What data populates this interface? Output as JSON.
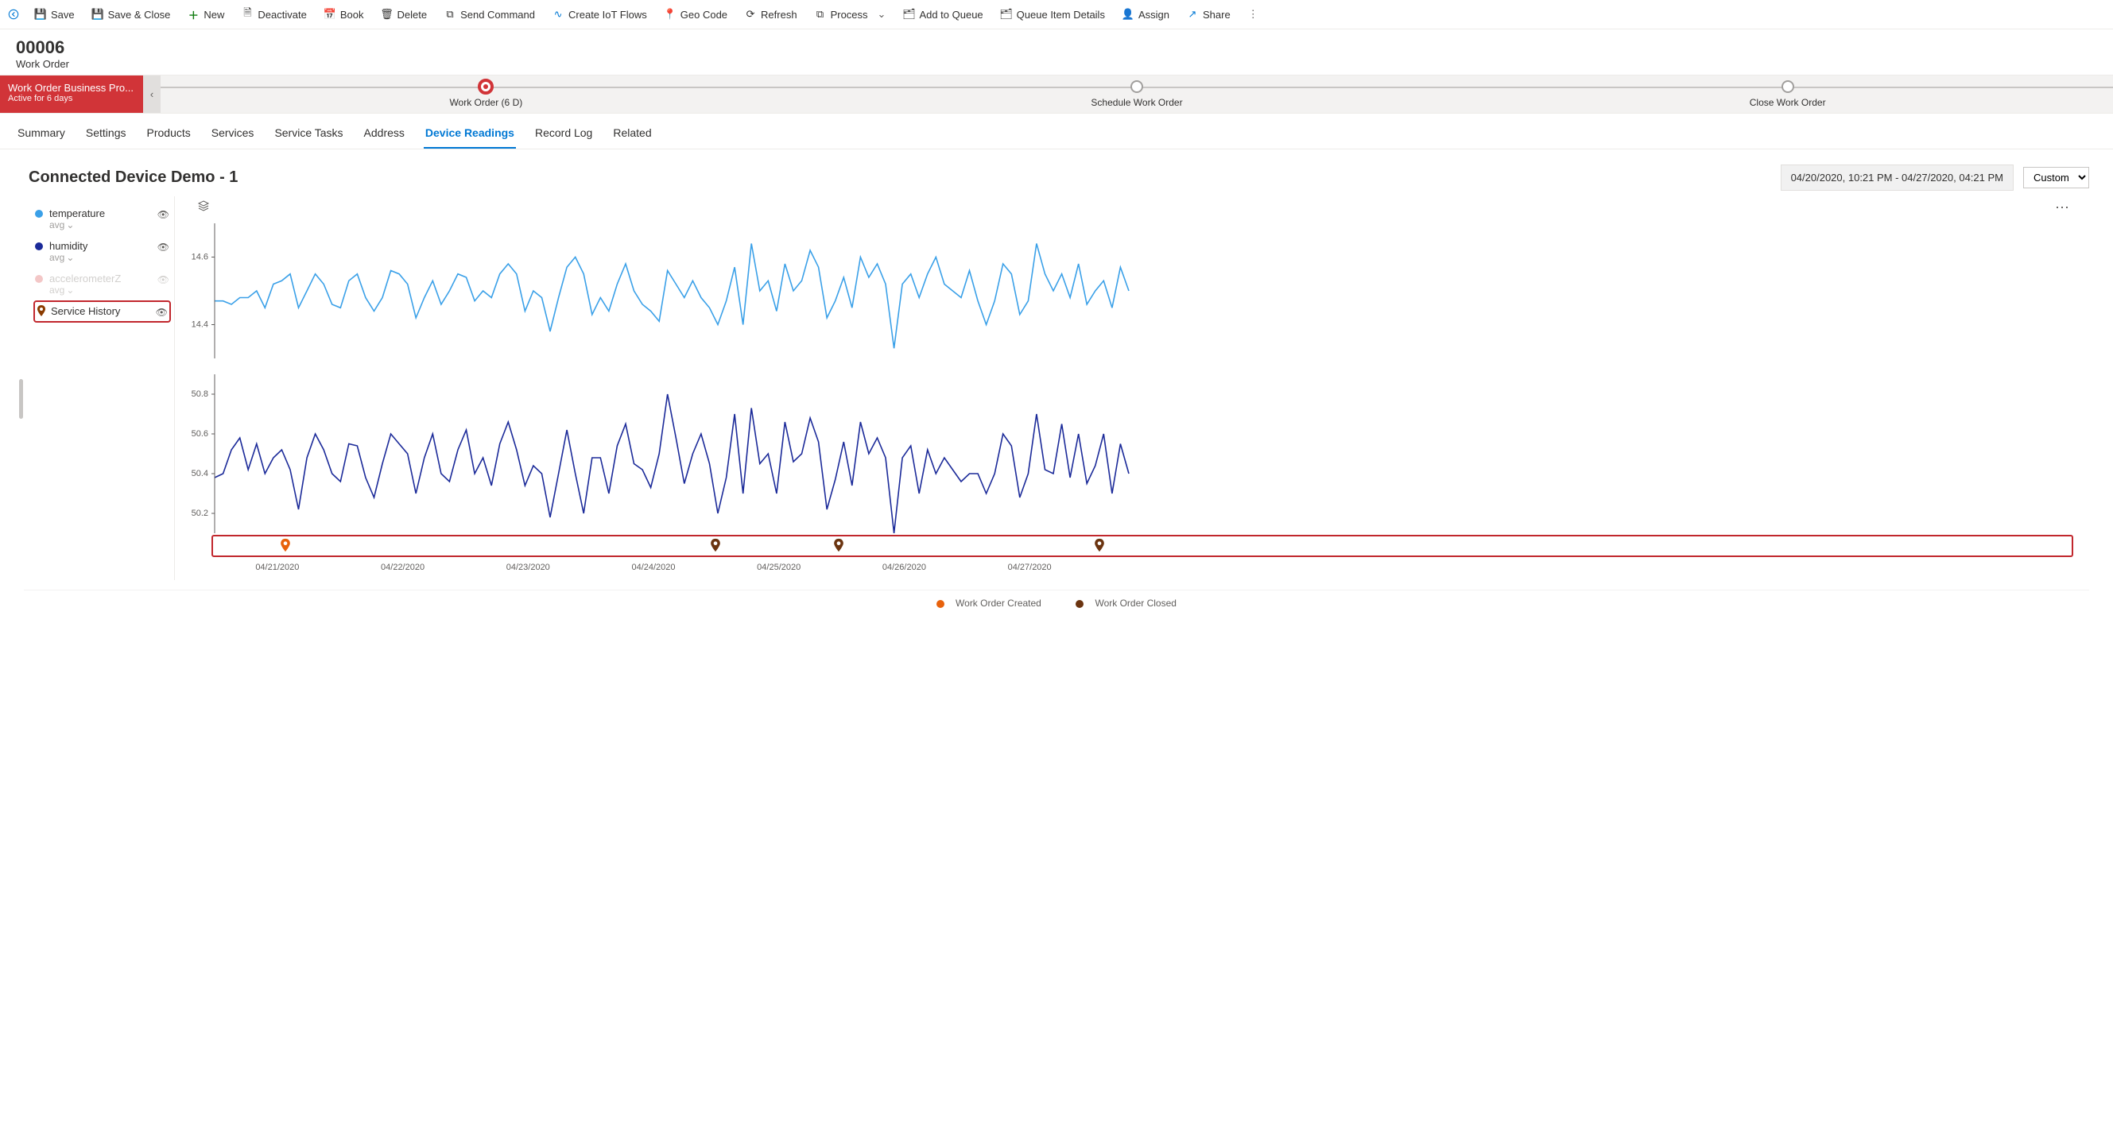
{
  "toolbar": {
    "save": "Save",
    "saveClose": "Save & Close",
    "new": "New",
    "deactivate": "Deactivate",
    "book": "Book",
    "delete": "Delete",
    "sendCommand": "Send Command",
    "createIot": "Create IoT Flows",
    "geoCode": "Geo Code",
    "refresh": "Refresh",
    "process": "Process",
    "addQueue": "Add to Queue",
    "queueDetails": "Queue Item Details",
    "assign": "Assign",
    "share": "Share"
  },
  "record": {
    "id": "00006",
    "type": "Work Order"
  },
  "process": {
    "name": "Work Order Business Pro...",
    "duration": "Active for 6 days",
    "stages": [
      {
        "label": "Work Order  (6 D)",
        "active": true
      },
      {
        "label": "Schedule Work Order",
        "active": false
      },
      {
        "label": "Close Work Order",
        "active": false
      }
    ]
  },
  "tabs": [
    "Summary",
    "Settings",
    "Products",
    "Services",
    "Service Tasks",
    "Address",
    "Device Readings",
    "Record Log",
    "Related"
  ],
  "activeTab": "Device Readings",
  "chart": {
    "title": "Connected Device Demo - 1",
    "range": "04/20/2020, 10:21 PM - 04/27/2020, 04:21 PM",
    "rangeMode": "Custom",
    "legend": [
      {
        "name": "temperature",
        "agg": "avg",
        "color": "#3aa0e8",
        "dim": false
      },
      {
        "name": "humidity",
        "agg": "avg",
        "color": "#1b2a99",
        "dim": false
      },
      {
        "name": "accelerometerZ",
        "agg": "avg",
        "color": "#f3c7c7",
        "dim": true
      }
    ],
    "serviceHistoryLabel": "Service History",
    "xTicks": [
      "04/21/2020",
      "04/22/2020",
      "04/23/2020",
      "04/24/2020",
      "04/25/2020",
      "04/26/2020",
      "04/27/2020"
    ],
    "bottomLegend": {
      "created": "Work Order Created",
      "closed": "Work Order Closed"
    }
  },
  "chart_data": [
    {
      "type": "line",
      "series_name": "temperature",
      "color": "#3aa0e8",
      "ylim": [
        14.3,
        14.7
      ],
      "yticks": [
        14.4,
        14.6
      ],
      "x_range": [
        "04/20/2020 22:21",
        "04/27/2020 16:21"
      ],
      "values": [
        14.47,
        14.47,
        14.46,
        14.48,
        14.48,
        14.5,
        14.45,
        14.52,
        14.53,
        14.55,
        14.45,
        14.5,
        14.55,
        14.52,
        14.46,
        14.45,
        14.53,
        14.55,
        14.48,
        14.44,
        14.48,
        14.56,
        14.55,
        14.52,
        14.42,
        14.48,
        14.53,
        14.46,
        14.5,
        14.55,
        14.54,
        14.47,
        14.5,
        14.48,
        14.55,
        14.58,
        14.55,
        14.44,
        14.5,
        14.48,
        14.38,
        14.48,
        14.57,
        14.6,
        14.55,
        14.43,
        14.48,
        14.44,
        14.52,
        14.58,
        14.5,
        14.46,
        14.44,
        14.41,
        14.56,
        14.52,
        14.48,
        14.53,
        14.48,
        14.45,
        14.4,
        14.47,
        14.57,
        14.4,
        14.64,
        14.5,
        14.53,
        14.44,
        14.58,
        14.5,
        14.53,
        14.62,
        14.57,
        14.42,
        14.47,
        14.54,
        14.45,
        14.6,
        14.54,
        14.58,
        14.52,
        14.33,
        14.52,
        14.55,
        14.48,
        14.55,
        14.6,
        14.52,
        14.5,
        14.48,
        14.56,
        14.47,
        14.4,
        14.47,
        14.58,
        14.55,
        14.43,
        14.47,
        14.64,
        14.55,
        14.5,
        14.55,
        14.48,
        14.58,
        14.46,
        14.5,
        14.53,
        14.45,
        14.57,
        14.5
      ]
    },
    {
      "type": "line",
      "series_name": "humidity",
      "color": "#1b2a99",
      "ylim": [
        50.1,
        50.9
      ],
      "yticks": [
        50.2,
        50.4,
        50.6,
        50.8
      ],
      "x_range": [
        "04/20/2020 22:21",
        "04/27/2020 16:21"
      ],
      "values": [
        50.38,
        50.4,
        50.52,
        50.58,
        50.42,
        50.55,
        50.4,
        50.48,
        50.52,
        50.42,
        50.22,
        50.48,
        50.6,
        50.52,
        50.4,
        50.36,
        50.55,
        50.54,
        50.38,
        50.28,
        50.45,
        50.6,
        50.55,
        50.5,
        50.3,
        50.48,
        50.6,
        50.4,
        50.36,
        50.52,
        50.62,
        50.4,
        50.48,
        50.34,
        50.55,
        50.66,
        50.52,
        50.34,
        50.44,
        50.4,
        50.18,
        50.4,
        50.62,
        50.4,
        50.2,
        50.48,
        50.48,
        50.3,
        50.54,
        50.65,
        50.45,
        50.42,
        50.33,
        50.5,
        50.8,
        50.58,
        50.35,
        50.5,
        50.6,
        50.45,
        50.2,
        50.38,
        50.7,
        50.3,
        50.73,
        50.45,
        50.5,
        50.3,
        50.66,
        50.46,
        50.5,
        50.68,
        50.56,
        50.22,
        50.37,
        50.56,
        50.34,
        50.66,
        50.5,
        50.58,
        50.48,
        50.1,
        50.48,
        50.54,
        50.3,
        50.52,
        50.4,
        50.48,
        50.42,
        50.36,
        50.4,
        50.4,
        50.3,
        50.4,
        50.6,
        50.54,
        50.28,
        50.4,
        50.7,
        50.42,
        50.4,
        50.65,
        50.38,
        50.6,
        50.35,
        50.44,
        50.6,
        50.3,
        50.55,
        50.4
      ]
    },
    {
      "type": "event_markers",
      "series_name": "Service History",
      "categories": [
        "Work Order Created",
        "Work Order Closed"
      ],
      "markers": [
        {
          "x_frac": 0.075,
          "type": "Work Order Created"
        },
        {
          "x_frac": 0.545,
          "type": "Work Order Closed"
        },
        {
          "x_frac": 0.68,
          "type": "Work Order Closed"
        },
        {
          "x_frac": 0.965,
          "type": "Work Order Closed"
        }
      ]
    }
  ]
}
